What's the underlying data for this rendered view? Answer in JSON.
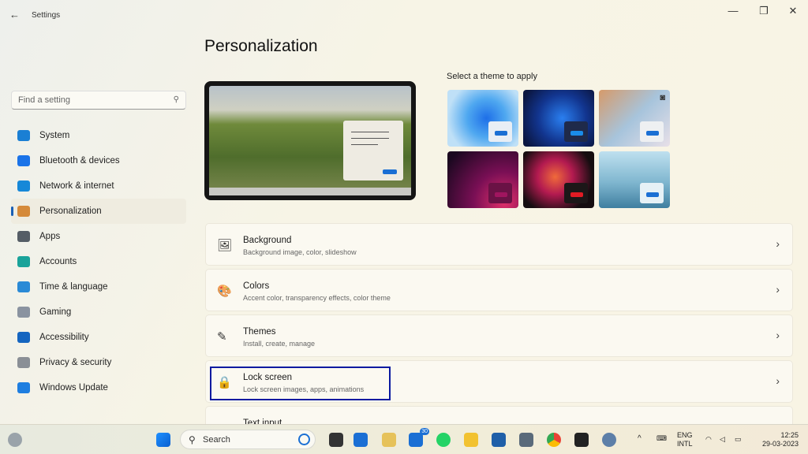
{
  "window": {
    "title": "Settings",
    "back": "←",
    "minimize": "—",
    "restore": "❐",
    "close": "✕"
  },
  "search": {
    "placeholder": "Find a setting"
  },
  "nav": [
    {
      "label": "System",
      "color": "#1a7fd4"
    },
    {
      "label": "Bluetooth & devices",
      "color": "#1a73e8"
    },
    {
      "label": "Network & internet",
      "color": "#1688d8"
    },
    {
      "label": "Personalization",
      "color": "#d58a3a",
      "selected": true
    },
    {
      "label": "Apps",
      "color": "#555d66"
    },
    {
      "label": "Accounts",
      "color": "#1aa39a"
    },
    {
      "label": "Time & language",
      "color": "#2a8ad6"
    },
    {
      "label": "Gaming",
      "color": "#8a93a0"
    },
    {
      "label": "Accessibility",
      "color": "#1565c0"
    },
    {
      "label": "Privacy & security",
      "color": "#8a8f96"
    },
    {
      "label": "Windows Update",
      "color": "#1e7ee0"
    }
  ],
  "page_title": "Personalization",
  "themes_label": "Select a theme to apply",
  "cards": [
    {
      "title": "Background",
      "subtitle": "Background image, color, slideshow",
      "icon": "🖼"
    },
    {
      "title": "Colors",
      "subtitle": "Accent color, transparency effects, color theme",
      "icon": "🎨"
    },
    {
      "title": "Themes",
      "subtitle": "Install, create, manage",
      "icon": "✎"
    },
    {
      "title": "Lock screen",
      "subtitle": "Lock screen images, apps, animations",
      "icon": "🔒"
    },
    {
      "title": "Text input",
      "subtitle": "",
      "icon": ""
    }
  ],
  "taskbar": {
    "search": "Search",
    "badge": "30",
    "lang1": "ENG",
    "lang2": "INTL",
    "time": "12:25",
    "date": "29-03-2023"
  },
  "accent": "#0a1aa0"
}
